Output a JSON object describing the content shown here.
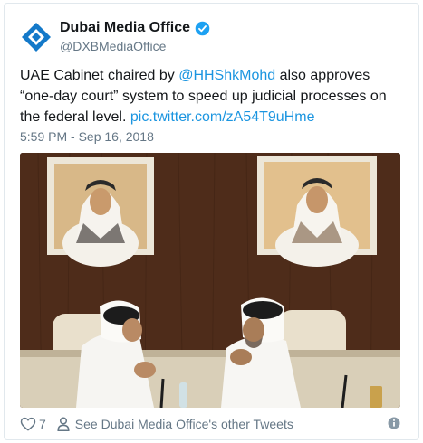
{
  "account": {
    "display_name": "Dubai Media Office",
    "handle": "@DXBMediaOffice",
    "verified": true,
    "avatar_icon": "dubai-media-office-logo"
  },
  "tweet": {
    "text_part1": "UAE Cabinet chaired by ",
    "mention": "@HHShkMohd",
    "text_part2": " also approves “one-day court” system to speed up judicial processes on the federal level. ",
    "media_link": "pic.twitter.com/zA54T9uHme",
    "timestamp": "5:59 PM - Sep 16, 2018"
  },
  "footer": {
    "like_count": "7",
    "other_tweets_label": "See Dubai Media Office's other Tweets"
  },
  "colors": {
    "link": "#1b95e0",
    "secondary_text": "#657786",
    "verified": "#1da1f2",
    "logo_blue": "#1479c9"
  }
}
